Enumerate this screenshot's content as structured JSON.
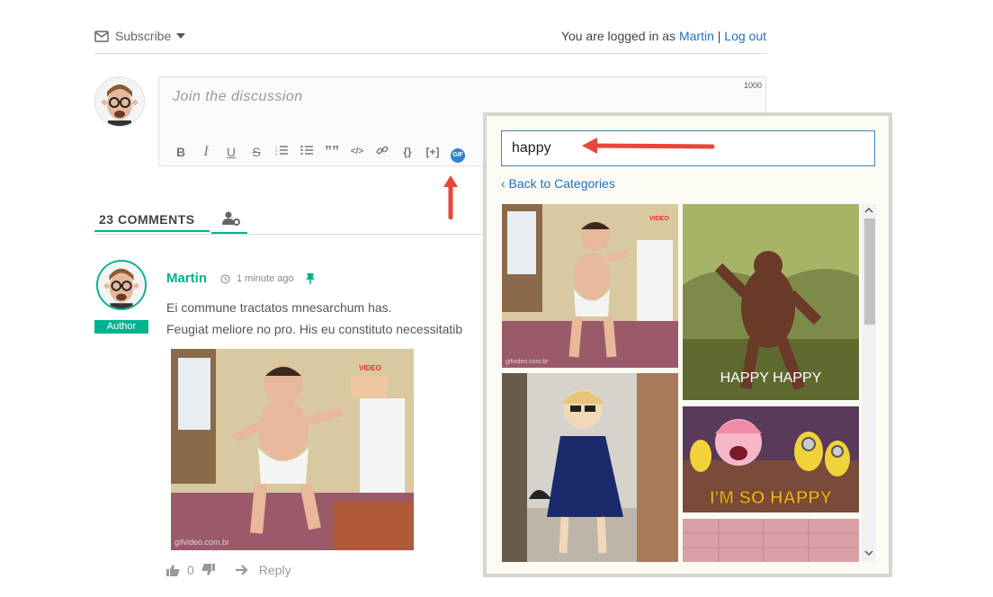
{
  "header": {
    "subscribe_label": "Subscribe",
    "logged_prefix": "You are logged in as",
    "username": "Martin",
    "separator": "|",
    "logout_label": "Log out"
  },
  "editor": {
    "placeholder": "Join the discussion",
    "char_limit": "1000",
    "toolbar": {
      "bold": "B",
      "italic": "I",
      "underline": "U",
      "strike": "S",
      "ordered_list": "ordered-list-icon",
      "unordered_list": "unordered-list-icon",
      "quote": "””",
      "code": "</>",
      "link": "link-icon",
      "curly": "{}",
      "spoiler": "[+]",
      "gif": "GIF"
    }
  },
  "comments": {
    "tab_label": "23 COMMENTS",
    "users_icon": "user-gear-icon"
  },
  "comment": {
    "author": "Martin",
    "time": "1 minute ago",
    "badge": "Author",
    "line1": "Ei commune tractatos mnesarchum has.",
    "line2": "Feugiat meliore no pro. His eu constituto necessitatib",
    "gif_watermark": "gifvideo.com.br",
    "gif_logo": "VIDEO",
    "votes": "0",
    "reply_label": "Reply"
  },
  "gif_popup": {
    "search_value": "happy",
    "back_label": "‹ Back to Categories",
    "tiles": [
      {
        "caption": "",
        "watermark": "gifvideo.com.br",
        "logo": "VIDEO"
      },
      {
        "caption": "HAPPY HAPPY"
      },
      {
        "caption": ""
      },
      {
        "caption": "I'M SO HAPPY"
      },
      {
        "caption": ""
      }
    ]
  },
  "colors": {
    "accent": "#00b38f",
    "link": "#1e73be",
    "annotation_arrow": "#e8463a",
    "gif_badge": "#3182ce"
  }
}
